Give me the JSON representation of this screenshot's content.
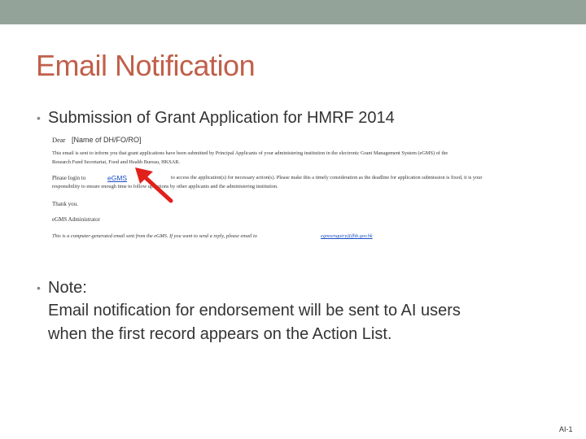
{
  "header": {
    "title": "Email Notification"
  },
  "bullets": {
    "first": "Submission of Grant Application for HMRF 2014",
    "note_label": "Note:",
    "note_line1": "Email notification for endorsement will be sent to AI users",
    "note_line2": "when the first record appears on the Action List."
  },
  "email": {
    "salutation": "Dear",
    "recipient": "[Name of DH/FO/RO]",
    "body1": "This email is sent to inform you that grant applications have been submitted by Principal Applicants of your administering institution in the electronic Grant Management System (eGMS) of the",
    "body2": "Research Fund Secretariat, Food and Health Bureau, HKSAR.",
    "login_prefix": "Please login to",
    "login_link": "eGMS",
    "login_suffix": "to access the application(s) for necessary action(s). Please make this a timely consideration as the deadline for application submission is fixed, it is your",
    "body3": "responsibility to ensure enough time to follow up actions by other applicants and the administering institution.",
    "thanks": "Thank you.",
    "signature": "eGMS Administrator",
    "footer_prefix": "This is a computer-generated email sent from the eGMS. If you want to send a reply, please email to",
    "footer_email": "egmsenquiry@fhb.gov.hk"
  },
  "footer": {
    "page": "AI-1"
  },
  "colors": {
    "top_bar": "#94a39a",
    "title": "#c0604a",
    "arrow": "#e0211b",
    "link": "#1a4fc4"
  }
}
